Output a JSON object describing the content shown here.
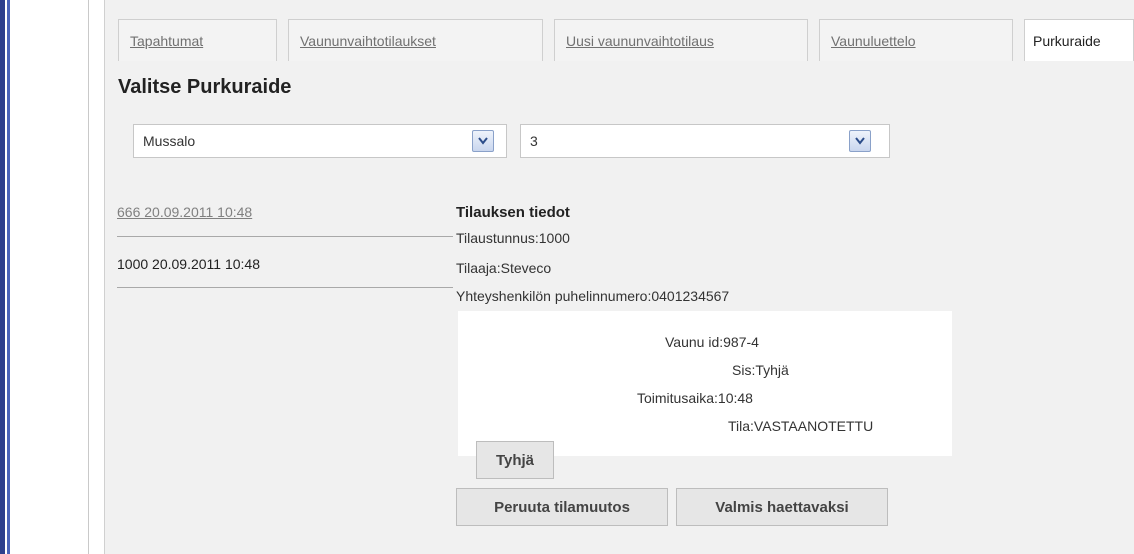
{
  "tabs": [
    {
      "label": "Tapahtumat",
      "active": false
    },
    {
      "label": "Vaununvaihtotilaukset",
      "active": false
    },
    {
      "label": "Uusi vaununvaihtotilaus",
      "active": false
    },
    {
      "label": "Vaunuluettelo",
      "active": false
    },
    {
      "label": "Purkuraide",
      "active": true
    }
  ],
  "heading": "Valitse Purkuraide",
  "location_select": {
    "value": "Mussalo"
  },
  "track_select": {
    "value": "3"
  },
  "orders": [
    {
      "label": "666 20.09.2011 10:48",
      "selected": false
    },
    {
      "label": "1000 20.09.2011 10:48",
      "selected": true
    }
  ],
  "details": {
    "title": "Tilauksen tiedot",
    "order_id": "Tilaustunnus:1000",
    "orderer": "Tilaaja:Steveco",
    "phone": "Yhteyshenkilön puhelinnumero:0401234567"
  },
  "wagon": {
    "id": "Vaunu id:987-4",
    "contents": "Sis:Tyhjä",
    "delivery_time": "Toimitusaika:10:48",
    "status": "Tila:VASTAANOTETTU"
  },
  "buttons": {
    "empty": "Tyhjä",
    "cancel": "Peruuta tilamuutos",
    "ready": "Valmis haettavaksi"
  },
  "colors": {
    "accent_bar": "#2d3f8c",
    "panel_bg": "#f1f1f1"
  }
}
